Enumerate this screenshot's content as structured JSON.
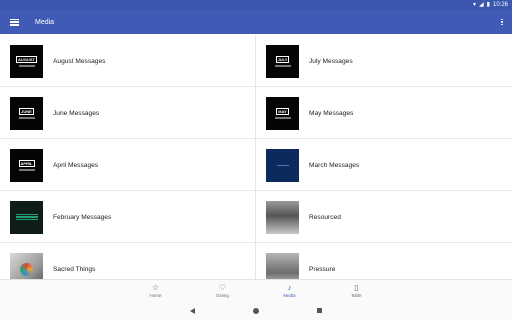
{
  "status": {
    "time": "10:26",
    "icons": [
      "wifi-icon",
      "signal-icon",
      "battery-icon"
    ]
  },
  "appbar": {
    "title": "Media",
    "menu_icon": "hamburger-icon",
    "overflow_icon": "more-vert-icon"
  },
  "colors": {
    "primary": "#3f5bb5",
    "status": "#3a56ad",
    "active_nav": "#3f5bb5"
  },
  "items": [
    {
      "title": "August Messages",
      "thumb": "AUGUST"
    },
    {
      "title": "July Messages",
      "thumb": "JULY"
    },
    {
      "title": "June Messages",
      "thumb": "JUNE"
    },
    {
      "title": "May Messages",
      "thumb": "MAY"
    },
    {
      "title": "April Messages",
      "thumb": "APRIL"
    },
    {
      "title": "March Messages"
    },
    {
      "title": "February Messages"
    },
    {
      "title": "Resourced"
    },
    {
      "title": "Sacred Things"
    },
    {
      "title": "Pressure"
    }
  ],
  "bottom_nav": [
    {
      "label": "Home",
      "icon": "star-icon"
    },
    {
      "label": "Giving",
      "icon": "heart-icon"
    },
    {
      "label": "Media",
      "icon": "mic-icon",
      "active": true
    },
    {
      "label": "Bible",
      "icon": "book-icon"
    }
  ],
  "system_nav": [
    "back-icon",
    "home-icon",
    "recents-icon"
  ]
}
